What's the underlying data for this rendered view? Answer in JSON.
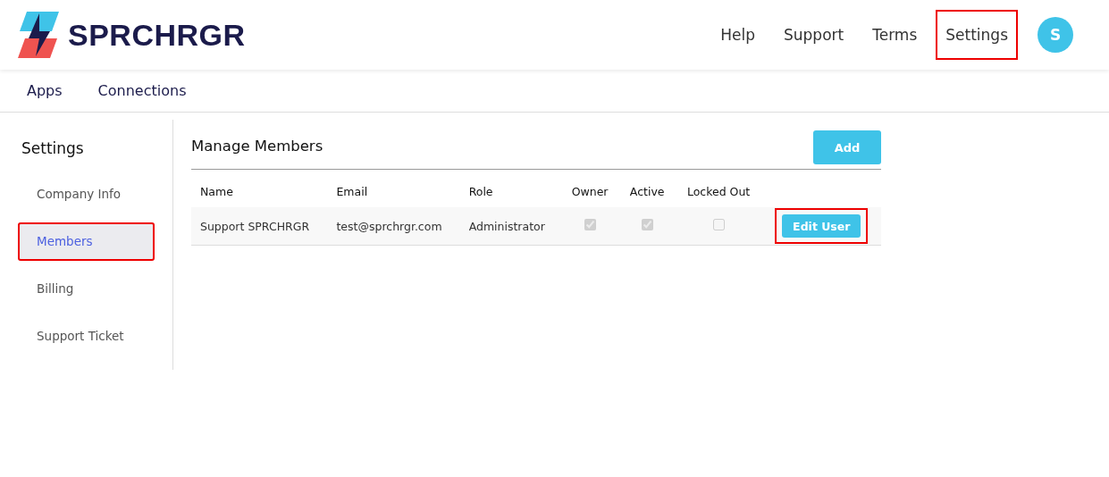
{
  "logo": {
    "text": "SPRCHRGR"
  },
  "top_nav": [
    {
      "label": "Help",
      "highlighted": false
    },
    {
      "label": "Support",
      "highlighted": false
    },
    {
      "label": "Terms",
      "highlighted": false
    },
    {
      "label": "Settings",
      "highlighted": true
    }
  ],
  "avatar": {
    "initial": "S"
  },
  "tabs": [
    {
      "label": "Apps"
    },
    {
      "label": "Connections"
    }
  ],
  "sidebar": {
    "title": "Settings",
    "items": [
      {
        "label": "Company Info",
        "selected": false,
        "highlighted": false
      },
      {
        "label": "Members",
        "selected": true,
        "highlighted": true
      },
      {
        "label": "Billing",
        "selected": false,
        "highlighted": false
      },
      {
        "label": "Support Ticket",
        "selected": false,
        "highlighted": false
      }
    ]
  },
  "main": {
    "title": "Manage Members",
    "add_button": "Add",
    "table": {
      "columns": [
        "Name",
        "Email",
        "Role",
        "Owner",
        "Active",
        "Locked Out"
      ],
      "rows": [
        {
          "name": "Support SPRCHRGR",
          "email": "test@sprchrgr.com",
          "role": "Administrator",
          "owner": true,
          "active": true,
          "locked_out": false,
          "edit_button": "Edit User",
          "edit_highlighted": true
        }
      ]
    }
  }
}
